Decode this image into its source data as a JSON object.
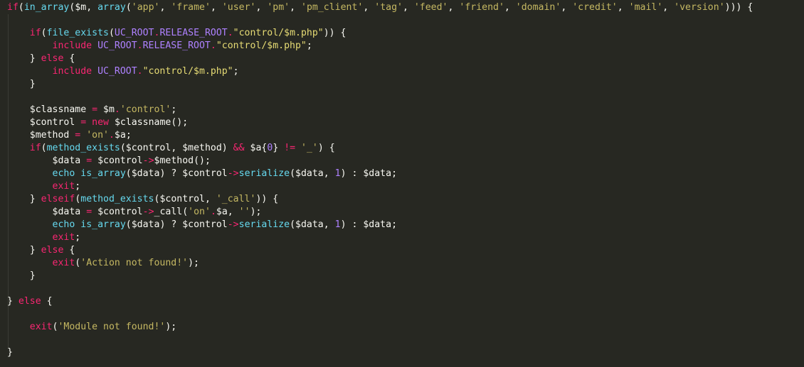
{
  "editor": {
    "language": "PHP",
    "theme": "monokai-dark",
    "background_color": "#272822",
    "default_text_color": "#f8f8f2",
    "colors": {
      "keyword": "#f92672",
      "function": "#66d9ef",
      "operator": "#f92672",
      "string_single": "#c5b862",
      "string_double": "#e6db74",
      "constant": "#ae81ff",
      "number": "#ae81ff",
      "punctuation": "#f8f8f2",
      "indent_guide": "#3b3c35"
    }
  },
  "code": {
    "lines": [
      {
        "id": 1,
        "indent": 0,
        "text": "if(in_array($m, array('app', 'frame', 'user', 'pm', 'pm_client', 'tag', 'feed', 'friend', 'domain', 'credit', 'mail', 'version'))) {",
        "tokens": [
          {
            "t": "if",
            "c": "kw"
          },
          {
            "t": "(",
            "c": "punc"
          },
          {
            "t": "in_array",
            "c": "fn"
          },
          {
            "t": "(",
            "c": "punc"
          },
          {
            "t": "$m",
            "c": "var"
          },
          {
            "t": ", ",
            "c": "punc"
          },
          {
            "t": "array",
            "c": "fn"
          },
          {
            "t": "(",
            "c": "punc"
          },
          {
            "t": "'app'",
            "c": "str"
          },
          {
            "t": ", ",
            "c": "punc"
          },
          {
            "t": "'frame'",
            "c": "str"
          },
          {
            "t": ", ",
            "c": "punc"
          },
          {
            "t": "'user'",
            "c": "str"
          },
          {
            "t": ", ",
            "c": "punc"
          },
          {
            "t": "'pm'",
            "c": "str"
          },
          {
            "t": ", ",
            "c": "punc"
          },
          {
            "t": "'pm_client'",
            "c": "str"
          },
          {
            "t": ", ",
            "c": "punc"
          },
          {
            "t": "'tag'",
            "c": "str"
          },
          {
            "t": ", ",
            "c": "punc"
          },
          {
            "t": "'feed'",
            "c": "str"
          },
          {
            "t": ", ",
            "c": "punc"
          },
          {
            "t": "'friend'",
            "c": "str"
          },
          {
            "t": ", ",
            "c": "punc"
          },
          {
            "t": "'domain'",
            "c": "str"
          },
          {
            "t": ", ",
            "c": "punc"
          },
          {
            "t": "'credit'",
            "c": "str"
          },
          {
            "t": ", ",
            "c": "punc"
          },
          {
            "t": "'mail'",
            "c": "str"
          },
          {
            "t": ", ",
            "c": "punc"
          },
          {
            "t": "'version'",
            "c": "str"
          },
          {
            "t": "))) {",
            "c": "punc"
          }
        ]
      },
      {
        "id": 2,
        "indent": 0,
        "text": "",
        "tokens": []
      },
      {
        "id": 3,
        "indent": 1,
        "text": "if(file_exists(UC_ROOT.RELEASE_ROOT.\"control/$m.php\")) {",
        "tokens": [
          {
            "t": "    ",
            "c": "plain"
          },
          {
            "t": "if",
            "c": "kw"
          },
          {
            "t": "(",
            "c": "punc"
          },
          {
            "t": "file_exists",
            "c": "fn"
          },
          {
            "t": "(",
            "c": "punc"
          },
          {
            "t": "UC_ROOT",
            "c": "const"
          },
          {
            "t": ".",
            "c": "op"
          },
          {
            "t": "RELEASE_ROOT",
            "c": "const"
          },
          {
            "t": ".",
            "c": "op"
          },
          {
            "t": "\"control/$m.php\"",
            "c": "dstr"
          },
          {
            "t": ")) {",
            "c": "punc"
          }
        ]
      },
      {
        "id": 4,
        "indent": 2,
        "text": "include UC_ROOT.RELEASE_ROOT.\"control/$m.php\";",
        "tokens": [
          {
            "t": "        ",
            "c": "plain"
          },
          {
            "t": "include",
            "c": "kw"
          },
          {
            "t": " ",
            "c": "plain"
          },
          {
            "t": "UC_ROOT",
            "c": "const"
          },
          {
            "t": ".",
            "c": "op"
          },
          {
            "t": "RELEASE_ROOT",
            "c": "const"
          },
          {
            "t": ".",
            "c": "op"
          },
          {
            "t": "\"control/$m.php\"",
            "c": "dstr"
          },
          {
            "t": ";",
            "c": "punc"
          }
        ]
      },
      {
        "id": 5,
        "indent": 1,
        "text": "} else {",
        "tokens": [
          {
            "t": "    ",
            "c": "plain"
          },
          {
            "t": "}",
            "c": "punc"
          },
          {
            "t": " ",
            "c": "plain"
          },
          {
            "t": "else",
            "c": "kw"
          },
          {
            "t": " {",
            "c": "punc"
          }
        ]
      },
      {
        "id": 6,
        "indent": 2,
        "text": "include UC_ROOT.\"control/$m.php\";",
        "tokens": [
          {
            "t": "        ",
            "c": "plain"
          },
          {
            "t": "include",
            "c": "kw"
          },
          {
            "t": " ",
            "c": "plain"
          },
          {
            "t": "UC_ROOT",
            "c": "const"
          },
          {
            "t": ".",
            "c": "op"
          },
          {
            "t": "\"control/$m.php\"",
            "c": "dstr"
          },
          {
            "t": ";",
            "c": "punc"
          }
        ]
      },
      {
        "id": 7,
        "indent": 1,
        "text": "}",
        "tokens": [
          {
            "t": "    ",
            "c": "plain"
          },
          {
            "t": "}",
            "c": "punc"
          }
        ]
      },
      {
        "id": 8,
        "indent": 0,
        "text": "",
        "tokens": []
      },
      {
        "id": 9,
        "indent": 1,
        "text": "$classname = $m.'control';",
        "tokens": [
          {
            "t": "    ",
            "c": "plain"
          },
          {
            "t": "$classname",
            "c": "var"
          },
          {
            "t": " ",
            "c": "plain"
          },
          {
            "t": "=",
            "c": "op"
          },
          {
            "t": " ",
            "c": "plain"
          },
          {
            "t": "$m",
            "c": "var"
          },
          {
            "t": ".",
            "c": "op"
          },
          {
            "t": "'control'",
            "c": "str"
          },
          {
            "t": ";",
            "c": "punc"
          }
        ]
      },
      {
        "id": 10,
        "indent": 1,
        "text": "$control = new $classname();",
        "tokens": [
          {
            "t": "    ",
            "c": "plain"
          },
          {
            "t": "$control",
            "c": "var"
          },
          {
            "t": " ",
            "c": "plain"
          },
          {
            "t": "=",
            "c": "op"
          },
          {
            "t": " ",
            "c": "plain"
          },
          {
            "t": "new",
            "c": "kw"
          },
          {
            "t": " ",
            "c": "plain"
          },
          {
            "t": "$classname",
            "c": "var"
          },
          {
            "t": "();",
            "c": "punc"
          }
        ]
      },
      {
        "id": 11,
        "indent": 1,
        "text": "$method = 'on'.$a;",
        "tokens": [
          {
            "t": "    ",
            "c": "plain"
          },
          {
            "t": "$method",
            "c": "var"
          },
          {
            "t": " ",
            "c": "plain"
          },
          {
            "t": "=",
            "c": "op"
          },
          {
            "t": " ",
            "c": "plain"
          },
          {
            "t": "'on'",
            "c": "str"
          },
          {
            "t": ".",
            "c": "op"
          },
          {
            "t": "$a",
            "c": "var"
          },
          {
            "t": ";",
            "c": "punc"
          }
        ]
      },
      {
        "id": 12,
        "indent": 1,
        "text": "if(method_exists($control, $method) && $a{0} != '_') {",
        "tokens": [
          {
            "t": "    ",
            "c": "plain"
          },
          {
            "t": "if",
            "c": "kw"
          },
          {
            "t": "(",
            "c": "punc"
          },
          {
            "t": "method_exists",
            "c": "fn"
          },
          {
            "t": "(",
            "c": "punc"
          },
          {
            "t": "$control",
            "c": "var"
          },
          {
            "t": ", ",
            "c": "punc"
          },
          {
            "t": "$method",
            "c": "var"
          },
          {
            "t": ") ",
            "c": "punc"
          },
          {
            "t": "&&",
            "c": "op"
          },
          {
            "t": " ",
            "c": "plain"
          },
          {
            "t": "$a",
            "c": "var"
          },
          {
            "t": "{",
            "c": "punc"
          },
          {
            "t": "0",
            "c": "num"
          },
          {
            "t": "} ",
            "c": "punc"
          },
          {
            "t": "!=",
            "c": "op"
          },
          {
            "t": " ",
            "c": "plain"
          },
          {
            "t": "'_'",
            "c": "str"
          },
          {
            "t": ") {",
            "c": "punc"
          }
        ]
      },
      {
        "id": 13,
        "indent": 2,
        "text": "$data = $control->$method();",
        "tokens": [
          {
            "t": "        ",
            "c": "plain"
          },
          {
            "t": "$data",
            "c": "var"
          },
          {
            "t": " ",
            "c": "plain"
          },
          {
            "t": "=",
            "c": "op"
          },
          {
            "t": " ",
            "c": "plain"
          },
          {
            "t": "$control",
            "c": "var"
          },
          {
            "t": "->",
            "c": "op"
          },
          {
            "t": "$method",
            "c": "var"
          },
          {
            "t": "();",
            "c": "punc"
          }
        ]
      },
      {
        "id": 14,
        "indent": 2,
        "text": "echo is_array($data) ? $control->serialize($data, 1) : $data;",
        "tokens": [
          {
            "t": "        ",
            "c": "plain"
          },
          {
            "t": "echo",
            "c": "fn"
          },
          {
            "t": " ",
            "c": "plain"
          },
          {
            "t": "is_array",
            "c": "fn"
          },
          {
            "t": "(",
            "c": "punc"
          },
          {
            "t": "$data",
            "c": "var"
          },
          {
            "t": ") ? ",
            "c": "punc"
          },
          {
            "t": "$control",
            "c": "var"
          },
          {
            "t": "->",
            "c": "op"
          },
          {
            "t": "serialize",
            "c": "fn"
          },
          {
            "t": "(",
            "c": "punc"
          },
          {
            "t": "$data",
            "c": "var"
          },
          {
            "t": ", ",
            "c": "punc"
          },
          {
            "t": "1",
            "c": "num"
          },
          {
            "t": ") : ",
            "c": "punc"
          },
          {
            "t": "$data",
            "c": "var"
          },
          {
            "t": ";",
            "c": "punc"
          }
        ]
      },
      {
        "id": 15,
        "indent": 2,
        "text": "exit;",
        "tokens": [
          {
            "t": "        ",
            "c": "plain"
          },
          {
            "t": "exit",
            "c": "kw"
          },
          {
            "t": ";",
            "c": "punc"
          }
        ]
      },
      {
        "id": 16,
        "indent": 1,
        "text": "} elseif(method_exists($control, '_call')) {",
        "tokens": [
          {
            "t": "    ",
            "c": "plain"
          },
          {
            "t": "}",
            "c": "punc"
          },
          {
            "t": " ",
            "c": "plain"
          },
          {
            "t": "elseif",
            "c": "kw"
          },
          {
            "t": "(",
            "c": "punc"
          },
          {
            "t": "method_exists",
            "c": "fn"
          },
          {
            "t": "(",
            "c": "punc"
          },
          {
            "t": "$control",
            "c": "var"
          },
          {
            "t": ", ",
            "c": "punc"
          },
          {
            "t": "'_call'",
            "c": "str"
          },
          {
            "t": ")) {",
            "c": "punc"
          }
        ]
      },
      {
        "id": 17,
        "indent": 2,
        "text": "$data = $control->_call('on'.$a, '');",
        "tokens": [
          {
            "t": "        ",
            "c": "plain"
          },
          {
            "t": "$data",
            "c": "var"
          },
          {
            "t": " ",
            "c": "plain"
          },
          {
            "t": "=",
            "c": "op"
          },
          {
            "t": " ",
            "c": "plain"
          },
          {
            "t": "$control",
            "c": "var"
          },
          {
            "t": "->",
            "c": "op"
          },
          {
            "t": "_call",
            "c": "plain"
          },
          {
            "t": "(",
            "c": "punc"
          },
          {
            "t": "'on'",
            "c": "str"
          },
          {
            "t": ".",
            "c": "op"
          },
          {
            "t": "$a",
            "c": "var"
          },
          {
            "t": ", ",
            "c": "punc"
          },
          {
            "t": "''",
            "c": "str"
          },
          {
            "t": ");",
            "c": "punc"
          }
        ]
      },
      {
        "id": 18,
        "indent": 2,
        "text": "echo is_array($data) ? $control->serialize($data, 1) : $data;",
        "tokens": [
          {
            "t": "        ",
            "c": "plain"
          },
          {
            "t": "echo",
            "c": "fn"
          },
          {
            "t": " ",
            "c": "plain"
          },
          {
            "t": "is_array",
            "c": "fn"
          },
          {
            "t": "(",
            "c": "punc"
          },
          {
            "t": "$data",
            "c": "var"
          },
          {
            "t": ") ? ",
            "c": "punc"
          },
          {
            "t": "$control",
            "c": "var"
          },
          {
            "t": "->",
            "c": "op"
          },
          {
            "t": "serialize",
            "c": "fn"
          },
          {
            "t": "(",
            "c": "punc"
          },
          {
            "t": "$data",
            "c": "var"
          },
          {
            "t": ", ",
            "c": "punc"
          },
          {
            "t": "1",
            "c": "num"
          },
          {
            "t": ") : ",
            "c": "punc"
          },
          {
            "t": "$data",
            "c": "var"
          },
          {
            "t": ";",
            "c": "punc"
          }
        ]
      },
      {
        "id": 19,
        "indent": 2,
        "text": "exit;",
        "tokens": [
          {
            "t": "        ",
            "c": "plain"
          },
          {
            "t": "exit",
            "c": "kw"
          },
          {
            "t": ";",
            "c": "punc"
          }
        ]
      },
      {
        "id": 20,
        "indent": 1,
        "text": "} else {",
        "tokens": [
          {
            "t": "    ",
            "c": "plain"
          },
          {
            "t": "}",
            "c": "punc"
          },
          {
            "t": " ",
            "c": "plain"
          },
          {
            "t": "else",
            "c": "kw"
          },
          {
            "t": " {",
            "c": "punc"
          }
        ]
      },
      {
        "id": 21,
        "indent": 2,
        "text": "exit('Action not found!');",
        "tokens": [
          {
            "t": "        ",
            "c": "plain"
          },
          {
            "t": "exit",
            "c": "kw"
          },
          {
            "t": "(",
            "c": "punc"
          },
          {
            "t": "'Action not found!'",
            "c": "str"
          },
          {
            "t": ");",
            "c": "punc"
          }
        ]
      },
      {
        "id": 22,
        "indent": 1,
        "text": "}",
        "tokens": [
          {
            "t": "    ",
            "c": "plain"
          },
          {
            "t": "}",
            "c": "punc"
          }
        ]
      },
      {
        "id": 23,
        "indent": 0,
        "text": "",
        "tokens": []
      },
      {
        "id": 24,
        "indent": 0,
        "text": "} else {",
        "tokens": [
          {
            "t": "}",
            "c": "punc"
          },
          {
            "t": " ",
            "c": "plain"
          },
          {
            "t": "else",
            "c": "kw"
          },
          {
            "t": " {",
            "c": "punc"
          }
        ]
      },
      {
        "id": 25,
        "indent": 0,
        "text": "",
        "tokens": []
      },
      {
        "id": 26,
        "indent": 1,
        "text": "exit('Module not found!');",
        "tokens": [
          {
            "t": "    ",
            "c": "plain"
          },
          {
            "t": "exit",
            "c": "kw"
          },
          {
            "t": "(",
            "c": "punc"
          },
          {
            "t": "'Module not found!'",
            "c": "str"
          },
          {
            "t": ");",
            "c": "punc"
          }
        ]
      },
      {
        "id": 27,
        "indent": 0,
        "text": "",
        "tokens": []
      },
      {
        "id": 28,
        "indent": 0,
        "text": "}",
        "tokens": [
          {
            "t": "}",
            "c": "punc"
          }
        ]
      }
    ]
  }
}
